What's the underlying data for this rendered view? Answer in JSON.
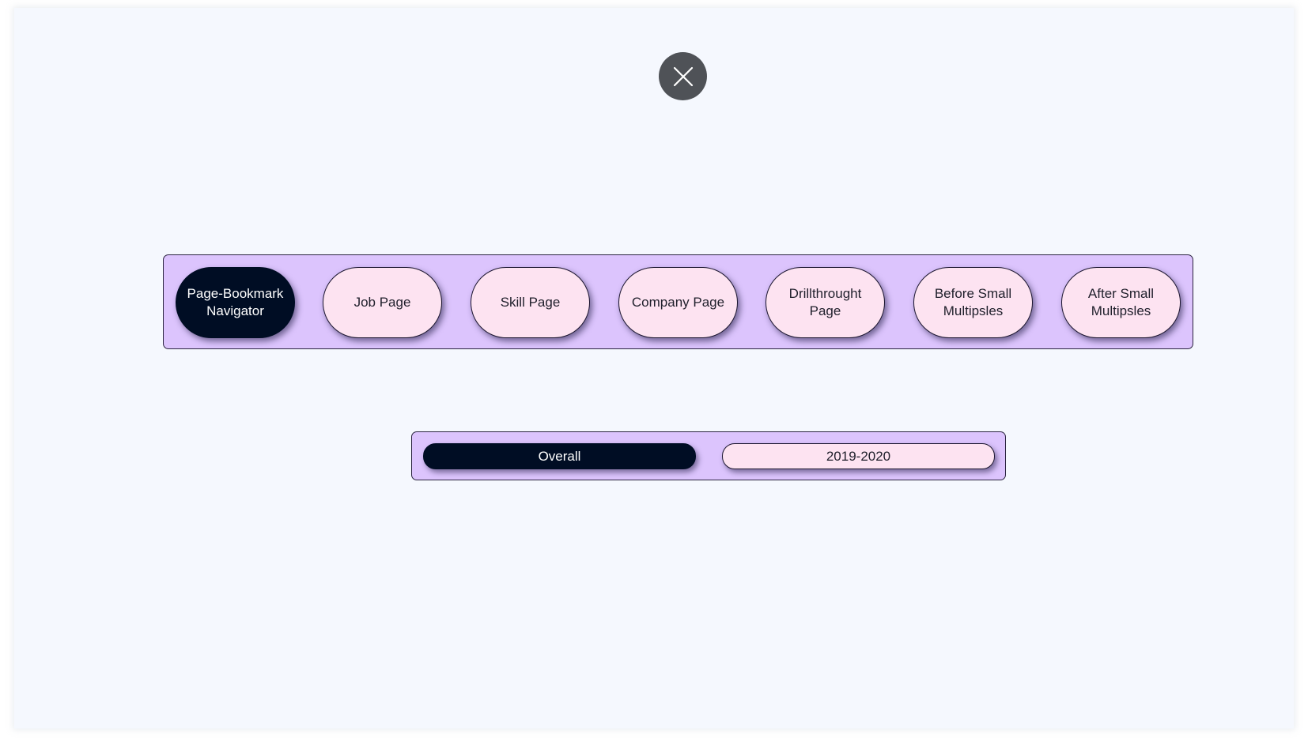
{
  "close_button": {
    "icon": "close-icon"
  },
  "navigator": {
    "items": [
      {
        "label": "Page-Bookmark Navigator",
        "active": true
      },
      {
        "label": "Job Page",
        "active": false
      },
      {
        "label": "Skill Page",
        "active": false
      },
      {
        "label": "Company Page",
        "active": false
      },
      {
        "label": "Drillthrought Page",
        "active": false
      },
      {
        "label": "Before Small Multipsles",
        "active": false
      },
      {
        "label": "After Small Multipsles",
        "active": false
      }
    ]
  },
  "period_toggle": {
    "items": [
      {
        "label": "Overall",
        "active": true
      },
      {
        "label": "2019-2020",
        "active": false
      }
    ]
  },
  "colors": {
    "page_background": "#f5f8fe",
    "bar_background": "#dcc4fd",
    "button_background": "#fde3f1",
    "active_button": "#000d24",
    "close_button": "#4f5257"
  }
}
